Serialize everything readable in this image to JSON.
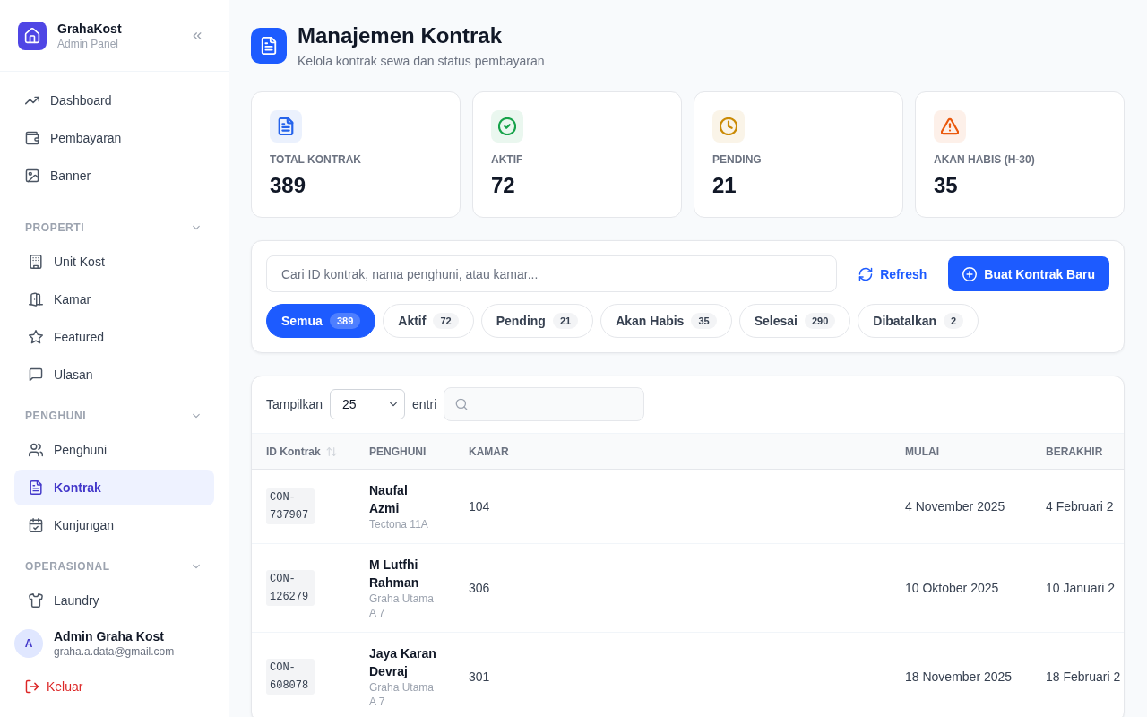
{
  "sidebar": {
    "brand": {
      "name": "GrahaKost",
      "subtitle": "Admin Panel"
    },
    "nav": [
      {
        "label": "Dashboard",
        "selected": false
      },
      {
        "label": "Pembayaran",
        "selected": false
      },
      {
        "label": "Banner",
        "selected": false
      }
    ],
    "sections": [
      {
        "title": "PROPERTI",
        "expanded": true,
        "items": [
          {
            "label": "Unit Kost",
            "selected": false
          },
          {
            "label": "Kamar",
            "selected": false
          },
          {
            "label": "Featured",
            "selected": false
          },
          {
            "label": "Ulasan",
            "selected": false
          }
        ]
      },
      {
        "title": "PENGHUNI",
        "expanded": true,
        "items": [
          {
            "label": "Penghuni",
            "selected": false
          },
          {
            "label": "Kontrak",
            "selected": true
          },
          {
            "label": "Kunjungan",
            "selected": false
          }
        ]
      },
      {
        "title": "OPERASIONAL",
        "expanded": true,
        "items": [
          {
            "label": "Laundry",
            "selected": false
          }
        ]
      }
    ],
    "user": {
      "initial": "A",
      "name": "Admin Graha Kost",
      "email": "graha.a.data@gmail.com"
    },
    "logout": "Keluar"
  },
  "header": {
    "title": "Manajemen Kontrak",
    "subtitle": "Kelola kontrak sewa dan status pembayaran"
  },
  "stats": [
    {
      "label": "TOTAL KONTRAK",
      "value": "389",
      "color": "#2563eb"
    },
    {
      "label": "AKTIF",
      "value": "72",
      "color": "#16a34a"
    },
    {
      "label": "PENDING",
      "value": "21",
      "color": "#ca8a04"
    },
    {
      "label": "AKAN HABIS (H-30)",
      "value": "35",
      "color": "#ea580c"
    }
  ],
  "toolbar": {
    "search": {
      "placeholder": "Cari ID kontrak, nama penghuni, atau kamar..."
    },
    "refresh": "Refresh",
    "create": "Buat Kontrak Baru"
  },
  "filters": [
    {
      "label": "Semua",
      "count": "389",
      "selected": true
    },
    {
      "label": "Aktif",
      "count": "72",
      "selected": false
    },
    {
      "label": "Pending",
      "count": "21",
      "selected": false
    },
    {
      "label": "Akan Habis",
      "count": "35",
      "selected": false
    },
    {
      "label": "Selesai",
      "count": "290",
      "selected": false
    },
    {
      "label": "Dibatalkan",
      "count": "2",
      "selected": false
    }
  ],
  "table": {
    "show_label": "Tampilkan",
    "page_size": "25",
    "entries_label": "entri",
    "columns": [
      {
        "label": "ID Kontrak",
        "sortable": true
      },
      {
        "label": "PENGHUNI",
        "sortable": false
      },
      {
        "label": "KAMAR",
        "sortable": false
      },
      {
        "label": "MULAI",
        "sortable": false
      },
      {
        "label": "BERAKHIR",
        "sortable": false
      }
    ],
    "rows": [
      {
        "id": "CON-737907",
        "tenant": "Naufal Azmi",
        "unit": "Tectona 11A",
        "room": "104",
        "start": "4 November 2025",
        "end": "4 Februari 2"
      },
      {
        "id": "CON-126279",
        "tenant": "M Lutfhi Rahman",
        "unit": "Graha Utama A 7",
        "room": "306",
        "start": "10 Oktober 2025",
        "end": "10 Januari 2"
      },
      {
        "id": "CON-608078",
        "tenant": "Jaya Karan Devraj",
        "unit": "Graha Utama A 7",
        "room": "301",
        "start": "18 November 2025",
        "end": "18 Februari 2"
      }
    ]
  }
}
